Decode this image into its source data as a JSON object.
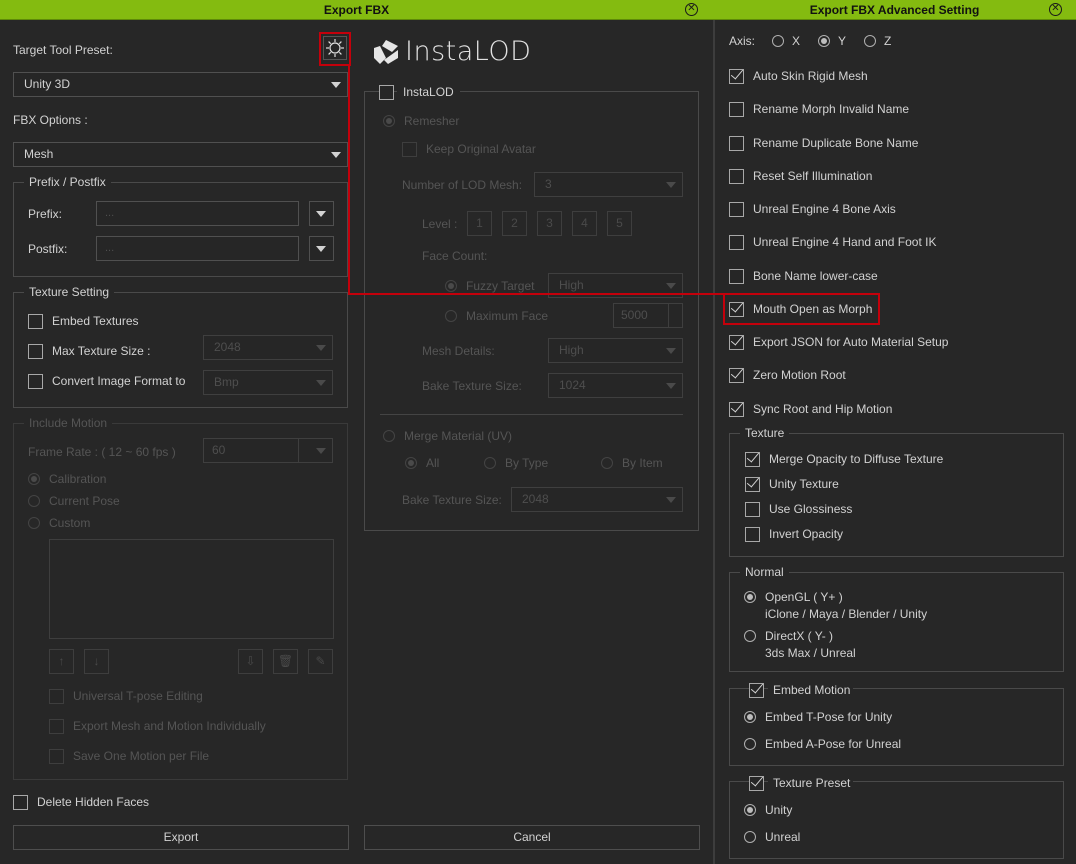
{
  "export_fbx": {
    "title": "Export FBX",
    "close_icon": "close-circle-icon",
    "target_tool_preset_label": "Target Tool Preset:",
    "preset_settings_icon": "gear-icon",
    "target_tool_preset_value": "Unity 3D",
    "fbx_options_label": "FBX Options :",
    "fbx_options_value": "Mesh",
    "prefix_postfix": {
      "legend": "Prefix / Postfix",
      "prefix_label": "Prefix:",
      "prefix_placeholder": "...",
      "postfix_label": "Postfix:",
      "postfix_placeholder": "..."
    },
    "texture_setting": {
      "legend": "Texture Setting",
      "embed_textures": {
        "label": "Embed Textures",
        "checked": false
      },
      "max_texture_size": {
        "label": "Max Texture Size :",
        "checked": false,
        "value": "2048"
      },
      "convert_image_format": {
        "label": "Convert Image Format to",
        "checked": false,
        "value": "Bmp"
      }
    },
    "include_motion": {
      "legend": "Include Motion",
      "frame_rate_label": "Frame Rate : ( 12 ~ 60 fps )",
      "frame_rate_value": "60",
      "poses": [
        {
          "label": "Calibration",
          "selected": true
        },
        {
          "label": "Current Pose",
          "selected": false
        },
        {
          "label": "Custom",
          "selected": false
        }
      ],
      "list_buttons": [
        "move-up-icon",
        "move-down-icon",
        "add-motion-icon",
        "delete-icon",
        "clear-icon"
      ],
      "universal_tpose": {
        "label": "Universal T-pose Editing",
        "checked": false
      },
      "export_individually": {
        "label": "Export Mesh and Motion Individually",
        "checked": false
      },
      "one_motion_per_file": {
        "label": "Save One Motion per File",
        "checked": false
      }
    },
    "delete_hidden_faces": {
      "label": "Delete Hidden Faces",
      "checked": false
    },
    "export_button": "Export",
    "cancel_button": "Cancel",
    "instalod": {
      "logo_text": "InstaLOD",
      "enable_label": "InstaLOD",
      "enabled": false,
      "remesher_label": "Remesher",
      "keep_original_avatar": "Keep Original Avatar",
      "lod_mesh_label": "Number of LOD Mesh:",
      "lod_mesh_value": "3",
      "level_label": "Level :",
      "levels": [
        "1",
        "2",
        "3",
        "4",
        "5"
      ],
      "face_count_label": "Face Count:",
      "fuzzy_target_label": "Fuzzy Target",
      "fuzzy_target_value": "High",
      "maximum_face_label": "Maximum Face",
      "maximum_face_value": "5000",
      "mesh_details_label": "Mesh Details:",
      "mesh_details_value": "High",
      "bake_texture_label": "Bake Texture Size:",
      "bake_texture_value": "1024",
      "merge_material_label": "Merge Material (UV)",
      "merge_options": [
        {
          "label": "All",
          "selected": true
        },
        {
          "label": "By Type",
          "selected": false
        },
        {
          "label": "By Item",
          "selected": false
        }
      ],
      "merge_bake_texture_label": "Bake Texture Size:",
      "merge_bake_texture_value": "2048"
    }
  },
  "advanced": {
    "title": "Export FBX Advanced Setting",
    "axis_label": "Axis:",
    "axes": [
      {
        "label": "X",
        "selected": false
      },
      {
        "label": "Y",
        "selected": true
      },
      {
        "label": "Z",
        "selected": false
      }
    ],
    "options": [
      {
        "label": "Auto Skin Rigid Mesh",
        "checked": true
      },
      {
        "label": "Rename Morph Invalid Name",
        "checked": false
      },
      {
        "label": "Rename Duplicate Bone Name",
        "checked": false
      },
      {
        "label": "Reset Self Illumination",
        "checked": false
      },
      {
        "label": "Unreal Engine 4 Bone Axis",
        "checked": false
      },
      {
        "label": "Unreal Engine 4 Hand and Foot IK",
        "checked": false
      },
      {
        "label": "Bone Name lower-case",
        "checked": false
      },
      {
        "label": "Mouth Open as Morph",
        "checked": true
      },
      {
        "label": "Export JSON for Auto Material Setup",
        "checked": true
      },
      {
        "label": "Zero Motion Root",
        "checked": true
      },
      {
        "label": "Sync Root and Hip Motion",
        "checked": true
      }
    ],
    "texture": {
      "legend": "Texture",
      "options": [
        {
          "label": "Merge Opacity to Diffuse Texture",
          "checked": true
        },
        {
          "label": "Unity Texture",
          "checked": true
        },
        {
          "label": "Use Glossiness",
          "checked": false
        },
        {
          "label": "Invert Opacity",
          "checked": false
        }
      ]
    },
    "normal": {
      "legend": "Normal",
      "options": [
        {
          "label": "OpenGL ( Y+ )",
          "sub": "iClone / Maya / Blender / Unity",
          "selected": true
        },
        {
          "label": "DirectX ( Y- )",
          "sub": "3ds Max / Unreal",
          "selected": false
        }
      ]
    },
    "embed_motion": {
      "legend": "Embed Motion",
      "checked": true,
      "options": [
        {
          "label": "Embed T-Pose for Unity",
          "selected": true
        },
        {
          "label": "Embed A-Pose for Unreal",
          "selected": false
        }
      ]
    },
    "texture_preset": {
      "legend": "Texture Preset",
      "checked": true,
      "options": [
        {
          "label": "Unity",
          "selected": true
        },
        {
          "label": "Unreal",
          "selected": false
        }
      ]
    }
  },
  "annotation_color": "#c4000b",
  "accent_color": "#84bb10"
}
